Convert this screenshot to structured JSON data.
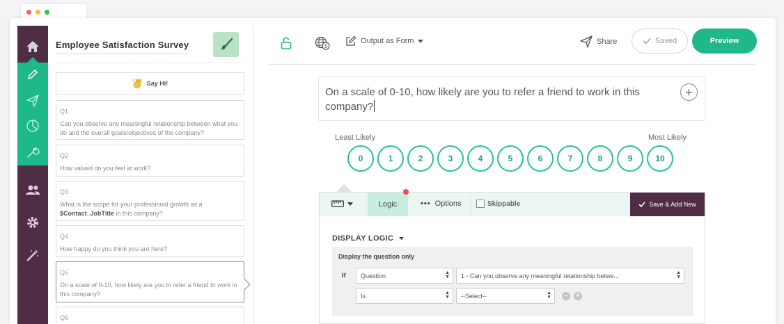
{
  "colors": {
    "accent": "#1eb88a",
    "rail": "#4e2d45",
    "dot_red": "#ff5f57",
    "dot_yellow": "#febc2e",
    "dot_green": "#28c840",
    "notification": "#e8504d"
  },
  "nav": {
    "items": [
      {
        "icon": "home-icon"
      },
      {
        "icon": "pencil-icon"
      },
      {
        "icon": "send-icon"
      },
      {
        "icon": "pie-chart-icon"
      },
      {
        "icon": "wrench-icon"
      },
      {
        "icon": "users-icon"
      },
      {
        "icon": "gear-icon"
      },
      {
        "icon": "magic-wand-icon"
      }
    ],
    "active": [
      "pencil-icon",
      "send-icon",
      "pie-chart-icon",
      "wrench-icon"
    ]
  },
  "survey": {
    "title": "Employee Satisfaction Survey",
    "say_hi": "Say Hi!",
    "questions": [
      {
        "num": "Q1",
        "text": "Can you observe any meaningful relationship between what you do and the overall goals/objectives of the company?"
      },
      {
        "num": "Q2",
        "text": "How valued do you feel at work?"
      },
      {
        "num": "Q3",
        "text_before": "What is the scope for your professional growth as a",
        "token": "$Contact_JobTitle",
        "text_after": "in this company?"
      },
      {
        "num": "Q4",
        "text": "How happy do you think you are here?"
      },
      {
        "num": "Q5",
        "text": "On a scale of 0-10, how likely are you to refer a friend to work in this company?"
      },
      {
        "num": "Q6",
        "text": ""
      }
    ],
    "selected_question": "Q5"
  },
  "toolbar": {
    "output_label": "Output as Form",
    "share_label": "Share",
    "saved_label": "Saved",
    "preview_label": "Preview"
  },
  "editor": {
    "question_text": "On a scale of 0-10, how likely are you to refer a friend to work in this company?",
    "least_label": "Least Likely",
    "most_label": "Most Likely",
    "scale": [
      "0",
      "1",
      "2",
      "3",
      "4",
      "5",
      "6",
      "7",
      "8",
      "9",
      "10"
    ]
  },
  "logic_panel": {
    "tab_logic": "Logic",
    "tab_options": "Options",
    "tab_skippable": "Skippable",
    "save_add_new": "Save & Add New",
    "display_logic_title": "DISPLAY LOGIC",
    "display_sub": "Display the question only",
    "if_label": "If",
    "sel_type": "Question",
    "sel_question": "1 - Can you observe any meaningful relationship betwe...",
    "sel_operator": "Is",
    "sel_value": "--Select--"
  }
}
